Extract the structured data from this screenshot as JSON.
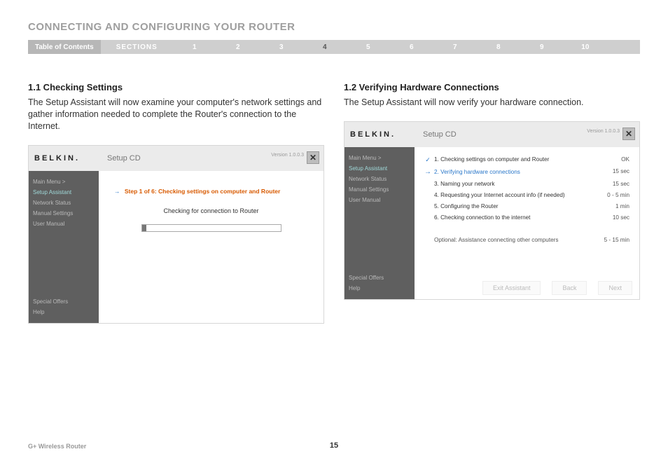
{
  "page": {
    "title": "CONNECTING AND CONFIGURING YOUR ROUTER",
    "footer_product": "G+ Wireless Router",
    "page_number": "15"
  },
  "nav": {
    "toc_label": "Table of Contents",
    "sections_label": "SECTIONS",
    "sections": [
      "1",
      "2",
      "3",
      "4",
      "5",
      "6",
      "7",
      "8",
      "9",
      "10"
    ],
    "active_index": 3
  },
  "left": {
    "heading": "1.1 Checking Settings",
    "body": "The Setup Assistant will now examine your computer's network settings and gather information needed to complete the Router's connection to the Internet."
  },
  "right": {
    "heading": "1.2 Verifying Hardware Connections",
    "body": "The Setup Assistant will now verify your hardware connection."
  },
  "app_common": {
    "brand": "BELKIN.",
    "header_title": "Setup CD",
    "version": "Version 1.0.0.3",
    "close_glyph": "✕",
    "sidebar": {
      "main_menu": "Main Menu  >",
      "setup_assistant": "Setup Assistant",
      "network_status": "Network Status",
      "manual_settings": "Manual Settings",
      "user_manual": "User Manual",
      "special_offers": "Special Offers",
      "help": "Help"
    },
    "buttons": {
      "exit": "Exit Assistant",
      "back": "Back",
      "next": "Next"
    }
  },
  "app_left": {
    "step_header": "Step 1 of 6: Checking settings on computer and Router",
    "checking_message": "Checking for connection to Router"
  },
  "app_right": {
    "steps": [
      {
        "mark": "✓",
        "state": "done",
        "label": "1. Checking settings on computer and Router",
        "time": "OK"
      },
      {
        "mark": "→",
        "state": "current",
        "label": "2. Verifying hardware connections",
        "time": "15 sec"
      },
      {
        "mark": "",
        "state": "",
        "label": "3. Naming your network",
        "time": "15 sec"
      },
      {
        "mark": "",
        "state": "",
        "label": "4. Requesting your Internet account info (if needed)",
        "time": "0 - 5 min"
      },
      {
        "mark": "",
        "state": "",
        "label": "5. Configuring the Router",
        "time": "1 min"
      },
      {
        "mark": "",
        "state": "",
        "label": "6. Checking connection to the internet",
        "time": "10 sec"
      }
    ],
    "optional": {
      "label": "Optional: Assistance connecting other computers",
      "time": "5 - 15 min"
    }
  }
}
